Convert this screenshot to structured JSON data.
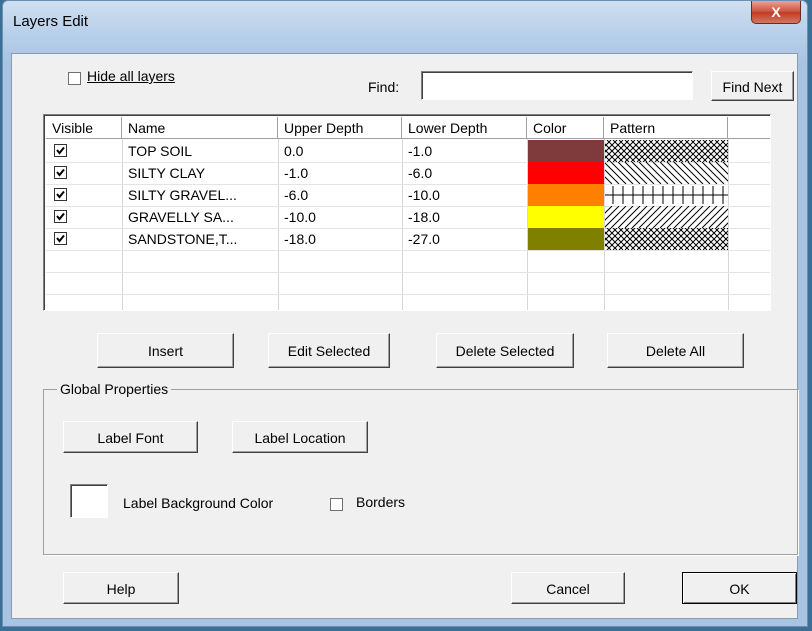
{
  "window": {
    "title": "Layers Edit",
    "close_glyph": "X"
  },
  "top": {
    "hide_all_label": "Hide all layers",
    "hide_all_checked": false,
    "find_label": "Find:",
    "find_value": "",
    "find_next_label": "Find Next"
  },
  "table": {
    "columns": [
      "Visible",
      "Name",
      "Upper Depth",
      "Lower Depth",
      "Color",
      "Pattern"
    ],
    "rows": [
      {
        "visible": true,
        "name": "TOP SOIL",
        "upper": "0.0",
        "lower": "-1.0",
        "color": "#7f3b3b",
        "pattern": "crosshatch"
      },
      {
        "visible": true,
        "name": "SILTY CLAY",
        "upper": "-1.0",
        "lower": "-6.0",
        "color": "#ff0000",
        "pattern": "back-diagonal"
      },
      {
        "visible": true,
        "name": "SILTY GRAVEL...",
        "upper": "-6.0",
        "lower": "-10.0",
        "color": "#ff8000",
        "pattern": "grid-line"
      },
      {
        "visible": true,
        "name": "GRAVELLY SA...",
        "upper": "-10.0",
        "lower": "-18.0",
        "color": "#ffff00",
        "pattern": "forward-diagonal"
      },
      {
        "visible": true,
        "name": "SANDSTONE,T...",
        "upper": "-18.0",
        "lower": "-27.0",
        "color": "#808000",
        "pattern": "crosshatch"
      }
    ]
  },
  "actions": {
    "insert": "Insert",
    "edit_selected": "Edit Selected",
    "delete_selected": "Delete Selected",
    "delete_all": "Delete All"
  },
  "global": {
    "title": "Global Properties",
    "label_font": "Label Font",
    "label_location": "Label Location",
    "bg_color_label": "Label Background Color",
    "borders_label": "Borders",
    "borders_checked": false
  },
  "footer": {
    "help": "Help",
    "cancel": "Cancel",
    "ok": "OK"
  }
}
